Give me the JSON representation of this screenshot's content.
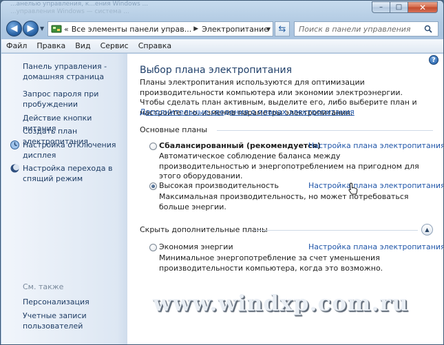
{
  "titlebar": {
    "ghost_line1": "...анелью управления, к...ения Windows ...",
    "ghost_line2": "...управления Windows — система ...",
    "minimize": "–",
    "maximize": "□",
    "close": "✕"
  },
  "nav": {
    "back": "◀",
    "forward": "▶",
    "crumb1": "Все элементы панели управ...",
    "crumb2": "Электропитание",
    "crumb_chevron_root": "«",
    "crumb_sep": "▶",
    "search_placeholder": "Поиск в панели управления"
  },
  "menu": [
    "Файл",
    "Правка",
    "Вид",
    "Сервис",
    "Справка"
  ],
  "left": {
    "home": "Панель управления - домашняя страница",
    "items": [
      "Запрос пароля при пробуждении",
      "Действие кнопки питания",
      "Создать план электропитания",
      "Настройка отключения дисплея",
      "Настройка перехода в спящий режим"
    ],
    "see_also": "См. также",
    "see_also_items": [
      "Персонализация",
      "Учетные записи пользователей"
    ]
  },
  "main": {
    "title": "Выбор плана электропитания",
    "description": "Планы электропитания используются для оптимизации производительности компьютера или экономии электроэнергии. Чтобы сделать план активным, выделите его, либо выберите план и настройте его, изменив параметры электропитания.",
    "more_link": "Дополнительные сведения о планах электропитания",
    "basic_header": "Основные планы",
    "hidden_header": "Скрыть дополнительные планы",
    "plans": [
      {
        "name": "Сбалансированный (рекомендуется)",
        "link": "Настройка плана электропитания",
        "desc": "Автоматическое соблюдение баланса между производительностью и энергопотреблением на пригодном для этого оборудовании.",
        "selected": false
      },
      {
        "name": "Высокая производительность",
        "link": "Настройка плана электропитания",
        "desc": "Максимальная производительность, но может потребоваться больше энергии.",
        "selected": true
      },
      {
        "name": "Экономия энергии",
        "link": "Настройка плана электропитания",
        "desc": "Минимальное энергопотребление за счет уменьшения производительности компьютера, когда это возможно.",
        "selected": false
      }
    ]
  },
  "help_label": "?",
  "watermark": "www.windxp.com.ru",
  "colors": {
    "link": "#1f55a8",
    "title": "#1f3f69",
    "window_frame": "#a9c3df"
  }
}
